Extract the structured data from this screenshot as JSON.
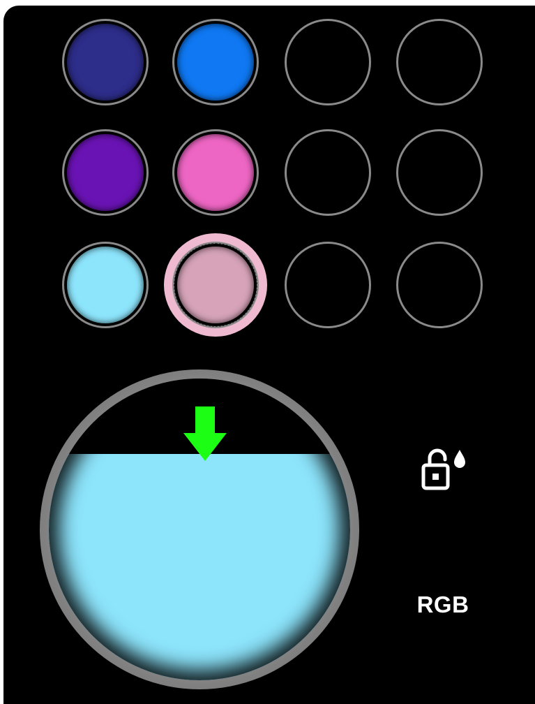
{
  "palette": {
    "swatches": [
      {
        "color": "#2d2d8a",
        "filled": true,
        "selected": false
      },
      {
        "color": "#0f78f2",
        "filled": true,
        "selected": false
      },
      {
        "color": null,
        "filled": false,
        "selected": false
      },
      {
        "color": null,
        "filled": false,
        "selected": false
      },
      {
        "color": "#6a13b4",
        "filled": true,
        "selected": false
      },
      {
        "color": "#ee66c4",
        "filled": true,
        "selected": false
      },
      {
        "color": null,
        "filled": false,
        "selected": false
      },
      {
        "color": null,
        "filled": false,
        "selected": false
      },
      {
        "color": "#8de5fc",
        "filled": true,
        "selected": false
      },
      {
        "color": "#d6a3b8",
        "filled": true,
        "selected": true,
        "halo": "#efb9cf"
      },
      {
        "color": null,
        "filled": false,
        "selected": false
      },
      {
        "color": null,
        "filled": false,
        "selected": false
      }
    ]
  },
  "dial": {
    "fill_color": "#8de5fc",
    "level_percent": 75,
    "arrow_color": "#1cff14",
    "arrow_icon": "arrow-down-icon"
  },
  "controls": {
    "lock_icon": "unlock-droplet-icon",
    "mode_label": "RGB"
  }
}
